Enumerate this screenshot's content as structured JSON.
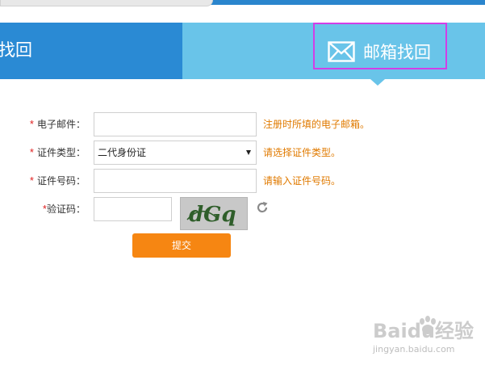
{
  "tabs": {
    "phone_label": "找回",
    "email_label": "邮箱找回"
  },
  "form": {
    "email": {
      "label": "电子邮件：",
      "value": "",
      "hint": "注册时所填的电子邮箱。"
    },
    "id_type": {
      "label": "证件类型：",
      "selected": "二代身份证",
      "hint": "请选择证件类型。"
    },
    "id_number": {
      "label": "证件号码：",
      "value": "",
      "hint": "请输入证件号码。"
    },
    "captcha": {
      "label": "验证码：",
      "value": "",
      "image_text": "dGq"
    },
    "required_mark": "*",
    "submit_label": "提交"
  },
  "watermark": {
    "brand": "Baidu经验",
    "url": "jingyan.baidu.com"
  },
  "colors": {
    "tab_active_bg": "#2a8ad4",
    "tab_inactive_bg": "#69c4e9",
    "highlight": "#d23ee6",
    "hint": "#e07a00",
    "required": "#e02020",
    "submit_bg": "#f68612"
  },
  "icons": {
    "email_tab": "mail-icon",
    "refresh": "refresh-icon"
  }
}
